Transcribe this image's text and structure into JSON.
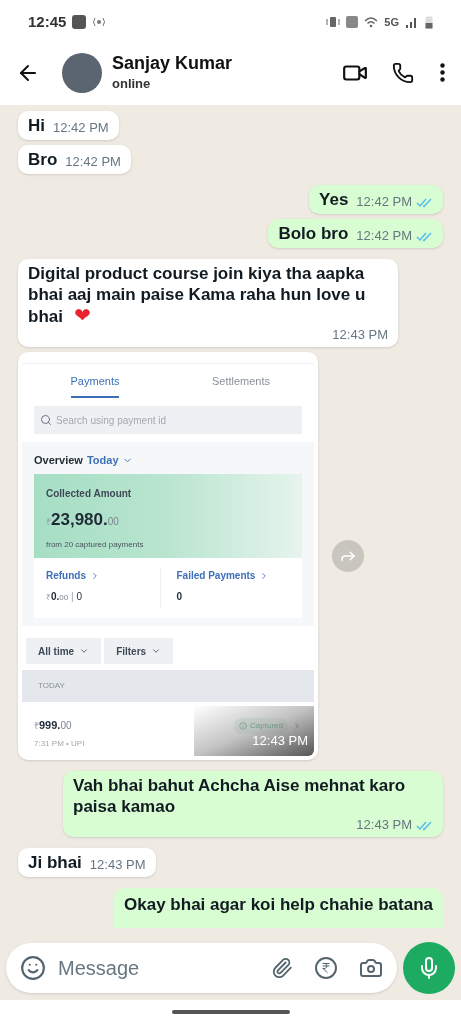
{
  "status_bar": {
    "time": "12:45",
    "network": "5G"
  },
  "header": {
    "name": "Sanjay Kumar",
    "status": "online"
  },
  "messages": [
    {
      "kind": "text",
      "outgoing": false,
      "text": "Hi",
      "time": "12:42 PM"
    },
    {
      "kind": "text",
      "outgoing": false,
      "text": "Bro",
      "time": "12:42 PM"
    },
    {
      "kind": "text",
      "outgoing": true,
      "text": "Yes",
      "time": "12:42 PM",
      "read": true
    },
    {
      "kind": "text",
      "outgoing": true,
      "text": "Bolo bro",
      "time": "12:42 PM",
      "read": true
    },
    {
      "kind": "text",
      "outgoing": false,
      "text": "Digital product course join kiya tha aapka bhai aaj main paise Kama raha hun love u bhai",
      "emoji": "❤",
      "time": "12:43 PM"
    },
    {
      "kind": "image",
      "outgoing": false,
      "time": "12:43 PM",
      "screen": {
        "tabs": [
          {
            "label": "Payments",
            "selected": true
          },
          {
            "label": "Settlements",
            "selected": false
          }
        ],
        "search": {
          "placeholder": "Search using payment id"
        },
        "overview": {
          "label": "Overview",
          "period": "Today"
        },
        "collected": {
          "title": "Collected Amount",
          "currency": "₹",
          "amount": "23,980.",
          "decimals": "00",
          "note": "from 20 captured payments"
        },
        "refunds": {
          "title": "Refunds",
          "currency": "₹",
          "amount": "0.",
          "decimals": "00",
          "separator": "|",
          "count": "0"
        },
        "failed": {
          "title": "Failed Payments",
          "count": "0"
        },
        "filters": [
          "All time",
          "Filters"
        ],
        "section": "TODAY",
        "transactions": [
          {
            "currency": "₹",
            "amount": "999.",
            "decimals": "00",
            "time": "7:31 PM",
            "dot": "•",
            "method": "UPI",
            "status": "Captured"
          }
        ]
      }
    },
    {
      "kind": "text",
      "outgoing": true,
      "text": "Vah bhai bahut Achcha Aise mehnat karo paisa kamao",
      "time": "12:43 PM",
      "read": true
    },
    {
      "kind": "text",
      "outgoing": false,
      "text": "Ji bhai",
      "time": "12:43 PM"
    },
    {
      "kind": "partial",
      "outgoing": true,
      "text": "Okay bhai agar koi help chahie batana"
    }
  ],
  "composer": {
    "placeholder": "Message"
  }
}
